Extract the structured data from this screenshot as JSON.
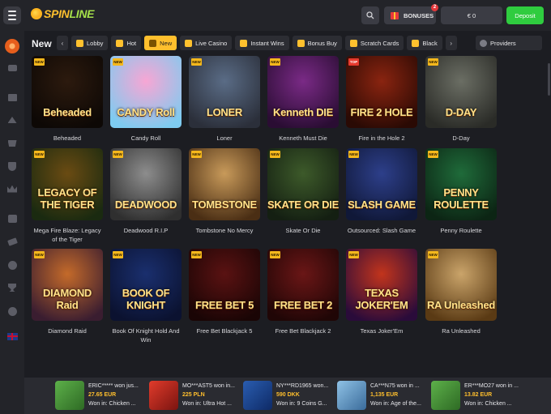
{
  "header": {
    "logo_text_1": "SPIN",
    "logo_text_2": "LINE",
    "bonuses_label": "BONUSES",
    "bonuses_count": "2",
    "balance": "€ 0",
    "deposit_label": "Deposit"
  },
  "categories": [
    "Lobby",
    "Hot",
    "New",
    "Live Casino",
    "Instant Wins",
    "Bonus Buy",
    "Scratch Cards",
    "Black"
  ],
  "active_category": "New",
  "providers_label": "Providers",
  "section_title": "New",
  "games": [
    {
      "name": "Beheaded",
      "thumb_text": "Beheaded",
      "ribbon": "NEW",
      "colors": [
        "#2c1a0e",
        "#0d0805"
      ]
    },
    {
      "name": "Candy Roll",
      "thumb_text": "CANDY Roll",
      "ribbon": "NEW",
      "colors": [
        "#f7a6d4",
        "#7ecbf0"
      ]
    },
    {
      "name": "Loner",
      "thumb_text": "LONER",
      "ribbon": "NEW",
      "colors": [
        "#5a6c86",
        "#2b2f3a"
      ]
    },
    {
      "name": "Kenneth Must Die",
      "thumb_text": "Kenneth DIE",
      "ribbon": "NEW",
      "colors": [
        "#7a2a86",
        "#2a0d33"
      ]
    },
    {
      "name": "Fire in the Hole 2",
      "thumb_text": "FIRE 2 HOLE",
      "ribbon": "TOP",
      "colors": [
        "#8a2410",
        "#2a0a04"
      ]
    },
    {
      "name": "D-Day",
      "thumb_text": "D-DAY",
      "ribbon": "NEW",
      "colors": [
        "#6b6e64",
        "#2a2b27"
      ]
    },
    {
      "name": "Mega Fire Blaze: Legacy of the Tiger",
      "thumb_text": "LEGACY OF THE TIGER",
      "ribbon": "NEW",
      "colors": [
        "#6a4b12",
        "#1a2a10"
      ]
    },
    {
      "name": "Deadwood R.I.P",
      "thumb_text": "DEADWOOD",
      "ribbon": "NEW",
      "colors": [
        "#8d8d8d",
        "#2f2f2f"
      ]
    },
    {
      "name": "Tombstone No Mercy",
      "thumb_text": "TOMBSTONE",
      "ribbon": "NEW",
      "colors": [
        "#c89a5a",
        "#4a2e14"
      ]
    },
    {
      "name": "Skate Or Die",
      "thumb_text": "SKATE OR DIE",
      "ribbon": "NEW",
      "colors": [
        "#3d5a2a",
        "#141f12"
      ]
    },
    {
      "name": "Outsourced: Slash Game",
      "thumb_text": "SLASH GAME",
      "ribbon": "NEW",
      "colors": [
        "#2d3f8a",
        "#101838"
      ]
    },
    {
      "name": "Penny Roulette",
      "thumb_text": "PENNY ROULETTE",
      "ribbon": "NEW",
      "colors": [
        "#1f6b3a",
        "#0c2514"
      ]
    },
    {
      "name": "Diamond Raid",
      "thumb_text": "DIAMOND Raid",
      "ribbon": "NEW",
      "colors": [
        "#c46a2a",
        "#3a1d30"
      ]
    },
    {
      "name": "Book Of Knight Hold And Win",
      "thumb_text": "BOOK OF KNIGHT",
      "ribbon": "NEW",
      "colors": [
        "#1a2f6e",
        "#0b1230"
      ]
    },
    {
      "name": "Free Bet Blackjack 5",
      "thumb_text": "FREE BET 5",
      "ribbon": "NEW",
      "colors": [
        "#5a1212",
        "#1a0505"
      ]
    },
    {
      "name": "Free Bet Blackjack 2",
      "thumb_text": "FREE BET 2",
      "ribbon": "NEW",
      "colors": [
        "#6a1616",
        "#200606"
      ]
    },
    {
      "name": "Texas Joker'Em",
      "thumb_text": "TEXAS JOKER'EM",
      "ribbon": "NEW",
      "colors": [
        "#c2341c",
        "#2a0b3a"
      ]
    },
    {
      "name": "Ra Unleashed",
      "thumb_text": "RA Unleashed",
      "ribbon": "NEW",
      "colors": [
        "#caa46a",
        "#5a3a14"
      ]
    }
  ],
  "winners": [
    {
      "user": "ERIC***** won jus...",
      "amount": "27.65 EUR",
      "game": "Won in: Chicken ...",
      "colors": [
        "#5db04a",
        "#2e6a24"
      ]
    },
    {
      "user": "MO***AST5 won in...",
      "amount": "225 PLN",
      "game": "Won in: Ultra Hot ...",
      "colors": [
        "#e13b2b",
        "#7a1410"
      ]
    },
    {
      "user": "NY***RD1965 won...",
      "amount": "590 DKK",
      "game": "Won in: 9 Coins G...",
      "colors": [
        "#2a5db0",
        "#0e2a66"
      ]
    },
    {
      "user": "CA***N75 won in ...",
      "amount": "1,135 EUR",
      "game": "Won in: Age of the...",
      "colors": [
        "#8fc2e6",
        "#3a6b9a"
      ]
    },
    {
      "user": "ER***MO27 won in ...",
      "amount": "13.82 EUR",
      "game": "Won in: Chicken ...",
      "colors": [
        "#5db04a",
        "#2e6a24"
      ]
    }
  ]
}
